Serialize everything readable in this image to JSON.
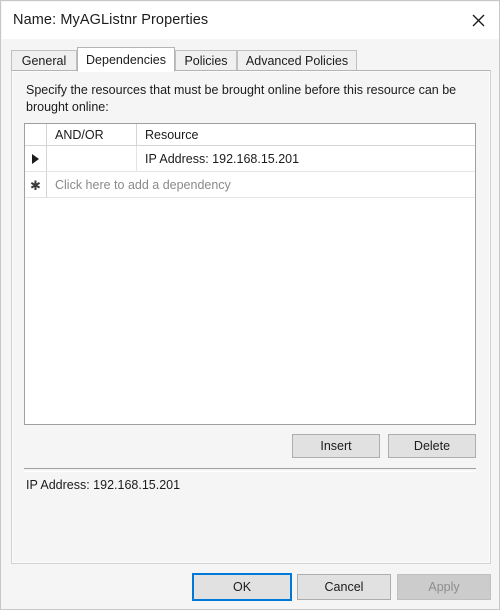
{
  "window": {
    "title": "Name: MyAGListnr Properties",
    "close_icon": "close-icon"
  },
  "tabs": [
    {
      "label": "General",
      "selected": false
    },
    {
      "label": "Dependencies",
      "selected": true
    },
    {
      "label": "Policies",
      "selected": false
    },
    {
      "label": "Advanced Policies",
      "selected": false
    }
  ],
  "dependencies_tab": {
    "instruction": "Specify the resources that must be brought online before this resource can be brought online:",
    "grid": {
      "columns": [
        "",
        "AND/OR",
        "Resource"
      ],
      "rows": [
        {
          "selector_icon": "row-current-arrow-icon",
          "and_or": "",
          "resource": "IP Address: 192.168.15.201"
        }
      ],
      "new_row": {
        "selector_icon": "row-new-asterisk-icon",
        "placeholder": "Click here to add a dependency"
      }
    },
    "insert_label": "Insert",
    "delete_label": "Delete",
    "status_text": "IP Address: 192.168.15.201"
  },
  "footer": {
    "ok_label": "OK",
    "cancel_label": "Cancel",
    "apply_label": "Apply",
    "apply_enabled": false
  },
  "colors": {
    "accent": "#0078d7",
    "dialog_background": "#f5f5f5",
    "titlebar_background": "#ffffff",
    "grid_background": "#ffffff",
    "button_face": "#e1e1e1",
    "button_disabled": "#cccccc",
    "text": "#1b1b1b",
    "text_disabled": "#8d8d8d",
    "placeholder_text": "#8a8a8a"
  }
}
